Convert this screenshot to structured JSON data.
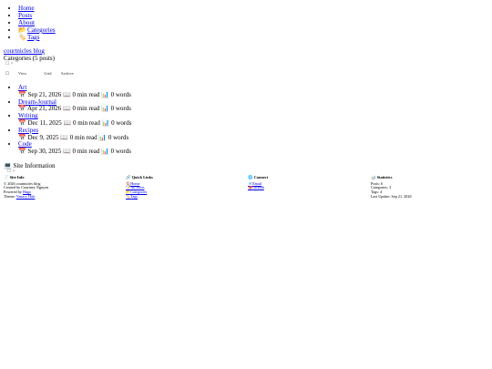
{
  "nav": {
    "home": "Home",
    "posts": "Posts",
    "about": "About",
    "categories": "Categories",
    "tags": "Tags"
  },
  "blog_link": "courtnicles blog",
  "categories_title": "Categories (5 posts)",
  "controls": {
    "close": "×"
  },
  "toolbar": {
    "view": "View",
    "grid": "Grid",
    "archive": "Archive"
  },
  "posts": [
    {
      "title": "Art",
      "date": "Sep 21, 2026",
      "read": "0 min read",
      "words": "0 words"
    },
    {
      "title": "Dream-Journal",
      "date": "Apr 21, 2026",
      "read": "0 min read",
      "words": "0 words"
    },
    {
      "title": "Writing",
      "date": "Dec 11, 2025",
      "read": "0 min read",
      "words": "0 words"
    },
    {
      "title": "Recipes",
      "date": "Dec 9, 2025",
      "read": "0 min read",
      "words": "0 words"
    },
    {
      "title": "Code",
      "date": "Sep 30, 2025",
      "read": "0 min read",
      "words": "0 words"
    }
  ],
  "site_info_title": "Site Information",
  "footer": {
    "site_info": {
      "heading": "Site Info",
      "copyright": "© 2026 courtnicles blog",
      "created_by": "Created by Courtney Nguyen",
      "powered_prefix": "Powered by",
      "powered_link": "Hugo",
      "theme_prefix": "Theme:",
      "theme_link": "Vanacy Hub"
    },
    "quick_links": {
      "heading": "Quick Links",
      "items": [
        "Home",
        "All Posts",
        "Categories",
        "Tags"
      ]
    },
    "connect": {
      "heading": "Connect",
      "items": [
        "Email",
        "GitHub"
      ]
    },
    "statistics": {
      "heading": "Statistics",
      "posts": "Posts: 6",
      "categories": "Categories: 3",
      "tags": "Tags: 4",
      "last_update": "Last Update: Sep 21, 2026"
    }
  }
}
